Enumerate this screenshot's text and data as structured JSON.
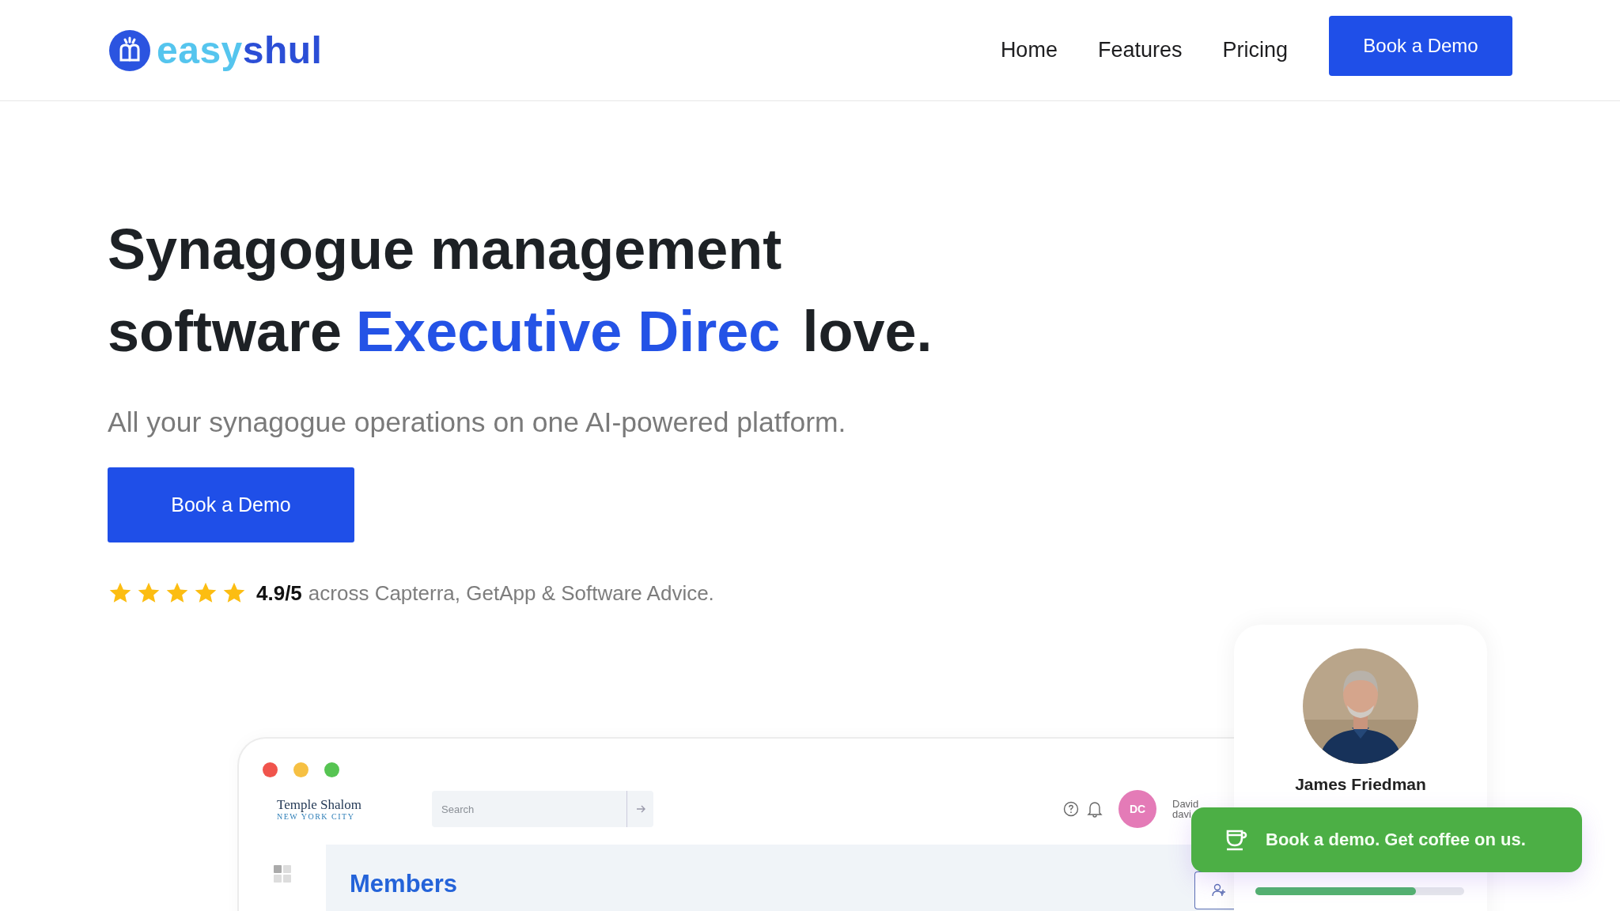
{
  "header": {
    "logo": {
      "part1": "easy",
      "part2": "shul"
    },
    "nav": [
      {
        "label": "Home"
      },
      {
        "label": "Features"
      },
      {
        "label": "Pricing"
      }
    ],
    "cta": "Book a Demo"
  },
  "hero": {
    "title_line1": "Synagogue management",
    "title_line2_start": "software",
    "highlight": "Executive Direc",
    "title_end": "love.",
    "subtitle": "All your synagogue operations on one AI-powered platform.",
    "button": "Book a Demo",
    "rating": {
      "stars": 5,
      "score": "4.9/5",
      "text": "across Capterra, GetApp & Software Advice."
    }
  },
  "app_preview": {
    "org_name": "Temple Shalom",
    "org_city": "NEW YORK CITY",
    "search_placeholder": "Search",
    "avatar_initials": "DC",
    "user_name": "David",
    "user_email": "davi",
    "page_title": "Members"
  },
  "testimonial": {
    "name": "James Friedman",
    "progress": {
      "level": 0.77
    }
  },
  "promo": {
    "text": "Book a demo. Get coffee on us."
  }
}
